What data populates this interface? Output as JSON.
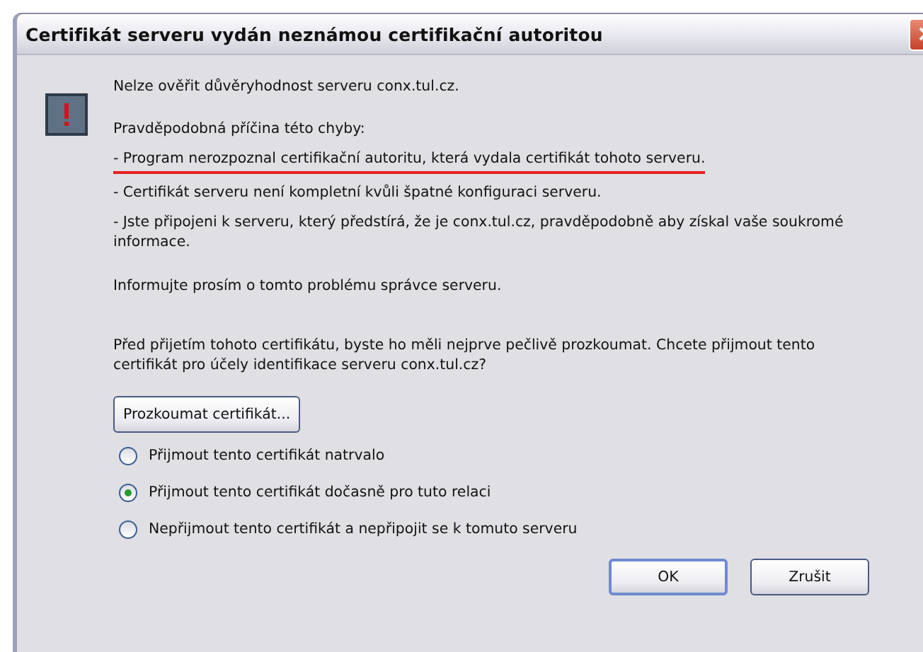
{
  "window": {
    "title": "Certifikát serveru vydán neznámou certifikační autoritou"
  },
  "message": "Nelze ověřit důvěryhodnost serveru conx.tul.cz.",
  "cause_heading": "Pravděpodobná příčina této chyby:",
  "causes": [
    {
      "text": "- Program nerozpoznal certifikační autoritu, která vydala certifikát tohoto serveru.",
      "underlined": true
    },
    {
      "text": "- Certifikát serveru není kompletní kvůli špatné konfiguraci serveru.",
      "underlined": false
    },
    {
      "text": "- Jste připojeni k serveru, který předstírá, že je conx.tul.cz, pravděpodobně aby získal vaše soukromé informace.",
      "underlined": false
    }
  ],
  "inform": "Informujte prosím o tomto problému správce serveru.",
  "question": "Před přijetím tohoto certifikátu, byste ho měli nejprve pečlivě prozkoumat. Chcete přijmout tento certifikát pro účely identifikace serveru conx.tul.cz?",
  "examine_button": "Prozkoumat certifikát...",
  "options": [
    {
      "label": "Přijmout tento certifikát natrvalo",
      "selected": false
    },
    {
      "label": "Přijmout tento certifikát dočasně pro tuto relaci",
      "selected": true
    },
    {
      "label": "Nepřijmout tento certifikát a nepřipojit se k tomuto serveru",
      "selected": false
    }
  ],
  "buttons": [
    "OK",
    "Zrušit"
  ]
}
